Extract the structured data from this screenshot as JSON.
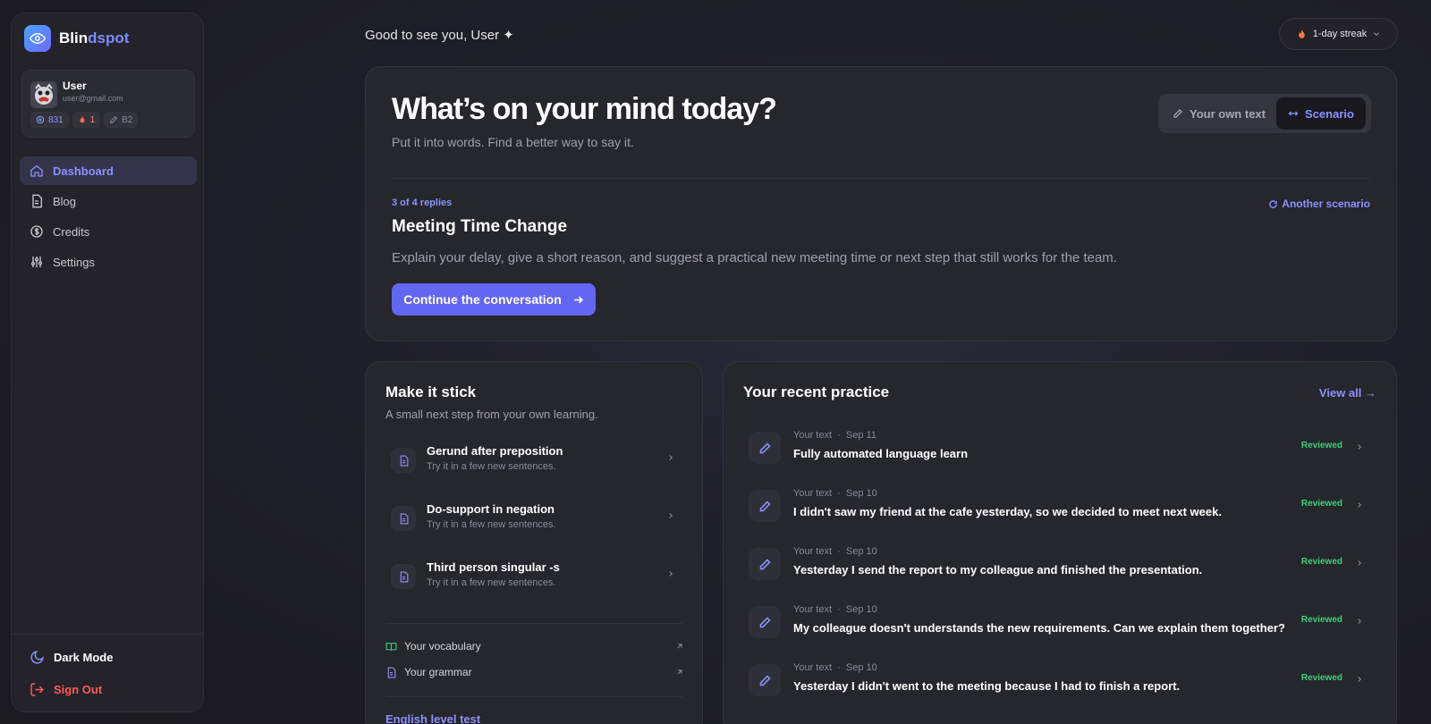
{
  "brand": {
    "name_prefix": "Blin",
    "name_suffix": "dspot"
  },
  "user": {
    "name": "User",
    "email": "user@gmail.com",
    "credits": "831",
    "streak": "1",
    "level": "B2"
  },
  "nav": {
    "items": [
      {
        "label": "Dashboard",
        "icon": "home-icon",
        "active": true
      },
      {
        "label": "Blog",
        "icon": "document-icon"
      },
      {
        "label": "Credits",
        "icon": "dollar-icon"
      },
      {
        "label": "Settings",
        "icon": "sliders-icon"
      }
    ],
    "dark_mode_label": "Dark Mode",
    "sign_out_label": "Sign Out"
  },
  "header": {
    "greeting": "Good to see you, User ✦",
    "streak_label": "1-day streak"
  },
  "hero": {
    "title": "What’s on your mind today?",
    "subtitle": "Put it into words. Find a better way to say it.",
    "mode_own": "Your own text",
    "mode_scenario": "Scenario",
    "progress": "3 of 4 replies",
    "another_scenario": "Another scenario",
    "scenario_title": "Meeting Time Change",
    "scenario_desc": "Explain your delay, give a short reason, and suggest a practical new meeting time or next step that still works for the team.",
    "cta_label": "Continue the conversation"
  },
  "stick": {
    "title": "Make it stick",
    "subtitle": "A small next step from your own learning.",
    "tips": [
      {
        "title": "Gerund after preposition",
        "sub": "Try it in a few new sentences."
      },
      {
        "title": "Do-support in negation",
        "sub": "Try it in a few new sentences."
      },
      {
        "title": "Third person singular -s",
        "sub": "Try it in a few new sentences."
      }
    ],
    "vocabulary_label": "Your vocabulary",
    "grammar_label": "Your grammar",
    "level_test_label": "English level test"
  },
  "recent": {
    "title": "Your recent practice",
    "view_all": "View all →",
    "items": [
      {
        "type": "Your text",
        "date": "Sep 11",
        "text": "Fully automated language learn",
        "status": "Reviewed"
      },
      {
        "type": "Your text",
        "date": "Sep 10",
        "text": "I didn't saw my friend at the cafe yesterday, so we decided to meet next week.",
        "status": "Reviewed"
      },
      {
        "type": "Your text",
        "date": "Sep 10",
        "text": "Yesterday I send the report to my colleague and finished the presentation.",
        "status": "Reviewed"
      },
      {
        "type": "Your text",
        "date": "Sep 10",
        "text": "My colleague doesn't understands the new requirements. Can we explain them together?",
        "status": "Reviewed"
      },
      {
        "type": "Your text",
        "date": "Sep 10",
        "text": "Yesterday I didn't went to the meeting because I had to finish a report.",
        "status": "Reviewed"
      }
    ]
  },
  "colors": {
    "accent": "#6366f1",
    "accent_text": "#8c92ff",
    "danger": "#ff5a5a",
    "success": "#3fcf75"
  }
}
